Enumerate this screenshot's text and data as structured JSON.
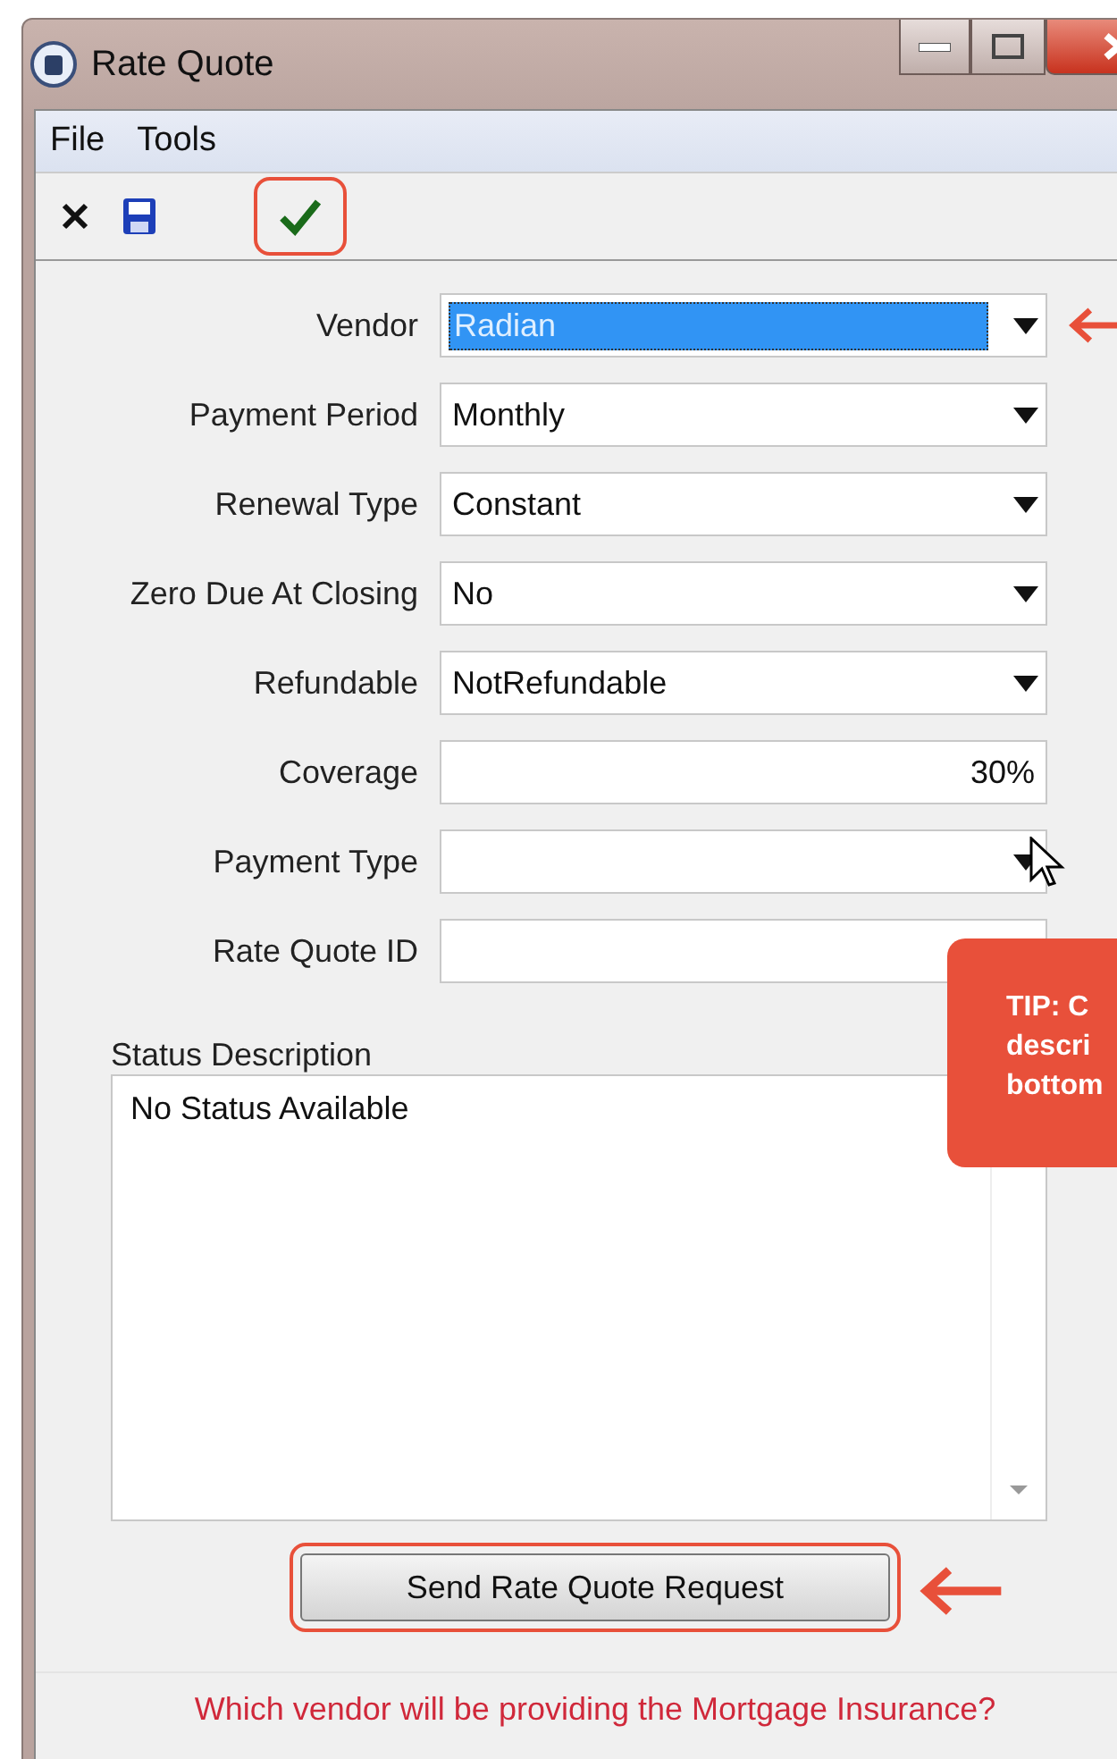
{
  "window": {
    "title": "Rate Quote"
  },
  "menu": [
    "File",
    "Tools"
  ],
  "toolbar": [
    {
      "kind": "close",
      "highlighted": false
    },
    {
      "kind": "save",
      "highlighted": false
    },
    {
      "kind": "check",
      "highlighted": true
    }
  ],
  "fields": [
    {
      "label": "Vendor",
      "kind": "dropdown",
      "value": "Radian",
      "focused": true,
      "arrow": true
    },
    {
      "label": "Payment Period",
      "kind": "dropdown",
      "value": "Monthly",
      "focused": false,
      "arrow": false
    },
    {
      "label": "Renewal Type",
      "kind": "dropdown",
      "value": "Constant",
      "focused": false,
      "arrow": false
    },
    {
      "label": "Zero Due At Closing",
      "kind": "dropdown",
      "value": "No",
      "focused": false,
      "arrow": false
    },
    {
      "label": "Refundable",
      "kind": "dropdown",
      "value": "NotRefundable",
      "focused": false,
      "arrow": false
    },
    {
      "label": "Coverage",
      "kind": "text",
      "value": "30%",
      "focused": false,
      "arrow": false
    },
    {
      "label": "Payment Type",
      "kind": "dropdown",
      "focused": false,
      "arrow": false
    },
    {
      "label": "Rate Quote ID",
      "kind": "text",
      "focused": false,
      "arrow": false
    }
  ],
  "status": {
    "label": "Status Description",
    "value": "No Status Available"
  },
  "send_button": {
    "label": "Send Rate Quote Request",
    "highlighted": true,
    "arrow": true
  },
  "hint": "Which vendor will be providing the Mortgage Insurance?",
  "tip": [
    "TIP: C",
    "descri",
    "bottom"
  ]
}
